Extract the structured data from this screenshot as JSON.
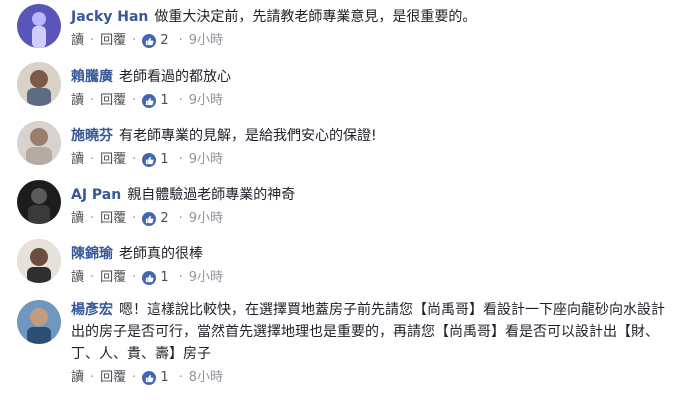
{
  "comments": [
    {
      "name": "Jacky Han",
      "text": "做重大決定前，先請教老師專業意見，是很重要的。",
      "actions": {
        "read": "讀",
        "reply": "回覆"
      },
      "likes": "2",
      "time": "9小時",
      "avatar_color": "#6a5acd"
    },
    {
      "name": "賴騰廣",
      "text": "老師看過的都放心",
      "actions": {
        "read": "讀",
        "reply": "回覆"
      },
      "likes": "1",
      "time": "9小時",
      "avatar_color": "#8d7b6a"
    },
    {
      "name": "施曉芬",
      "text": "有老師專業的見解，是給我們安心的保證!",
      "actions": {
        "read": "讀",
        "reply": "回覆"
      },
      "likes": "1",
      "time": "9小時",
      "avatar_color": "#9c8f86"
    },
    {
      "name": "AJ Pan",
      "text": "親自體驗過老師專業的神奇",
      "actions": {
        "read": "讀",
        "reply": "回覆"
      },
      "likes": "2",
      "time": "9小時",
      "avatar_color": "#2b2b2b"
    },
    {
      "name": "陳錦瑜",
      "text": "老師真的很棒",
      "actions": {
        "read": "讀",
        "reply": "回覆"
      },
      "likes": "1",
      "time": "9小時",
      "avatar_color": "#5b4a3f"
    },
    {
      "name": "楊彥宏",
      "text": "嗯！這樣說比較快，在選擇買地蓋房子前先請您【尚禹哥】看設計一下座向龍砂向水設計出的房子是否可行，當然首先選擇地理也是重要的，再請您【尚禹哥】看是否可以設計出【財、丁、人、貴、壽】房子",
      "actions": {
        "read": "讀",
        "reply": "回覆"
      },
      "likes": "1",
      "time": "8小時",
      "avatar_color": "#3f6e9a"
    }
  ]
}
